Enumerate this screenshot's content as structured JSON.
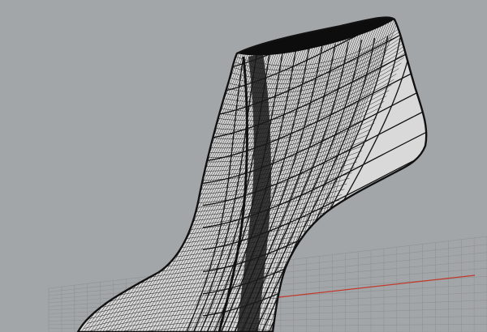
{
  "viewport": {
    "background": "#a3a6a8",
    "grid_color": "#8f9294",
    "axis_colors": {
      "x": "#c0392b",
      "y": "#27ae60"
    }
  },
  "model": {
    "mesh_color": "#111111",
    "surface_color": "#d9d9d9",
    "icon": "shoe-wireframe"
  }
}
